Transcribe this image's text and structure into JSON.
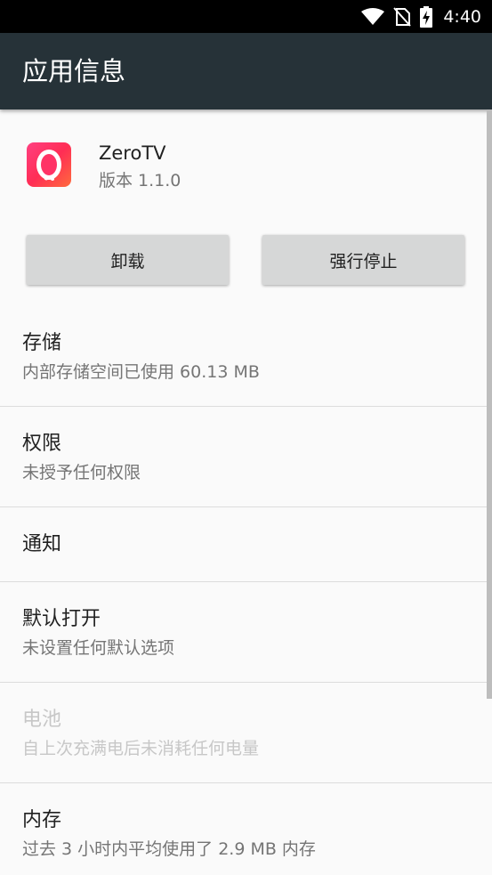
{
  "status_bar": {
    "time": "4:40",
    "icons": [
      "wifi-icon",
      "no-sim-icon",
      "battery-charging-icon"
    ]
  },
  "app_bar": {
    "title": "应用信息"
  },
  "app": {
    "name": "ZeroTV",
    "version": "版本 1.1.0",
    "icon": "zerotv-app-icon"
  },
  "buttons": {
    "uninstall": "卸载",
    "force_stop": "强行停止"
  },
  "items": [
    {
      "title": "存储",
      "subtitle": "内部存储空间已使用 60.13 MB",
      "enabled": true
    },
    {
      "title": "权限",
      "subtitle": "未授予任何权限",
      "enabled": true
    },
    {
      "title": "通知",
      "subtitle": "",
      "enabled": true
    },
    {
      "title": "默认打开",
      "subtitle": "未设置任何默认选项",
      "enabled": true
    },
    {
      "title": "电池",
      "subtitle": "自上次充满电后未消耗任何电量",
      "enabled": false
    },
    {
      "title": "内存",
      "subtitle": "过去 3 小时内平均使用了 2.9 MB 内存",
      "enabled": true
    }
  ],
  "colors": {
    "app_bar": "#263238",
    "status_bar": "#000000",
    "background": "#fafafa",
    "button": "#d6d7d7",
    "disabled_text": "#c7c7c7"
  }
}
